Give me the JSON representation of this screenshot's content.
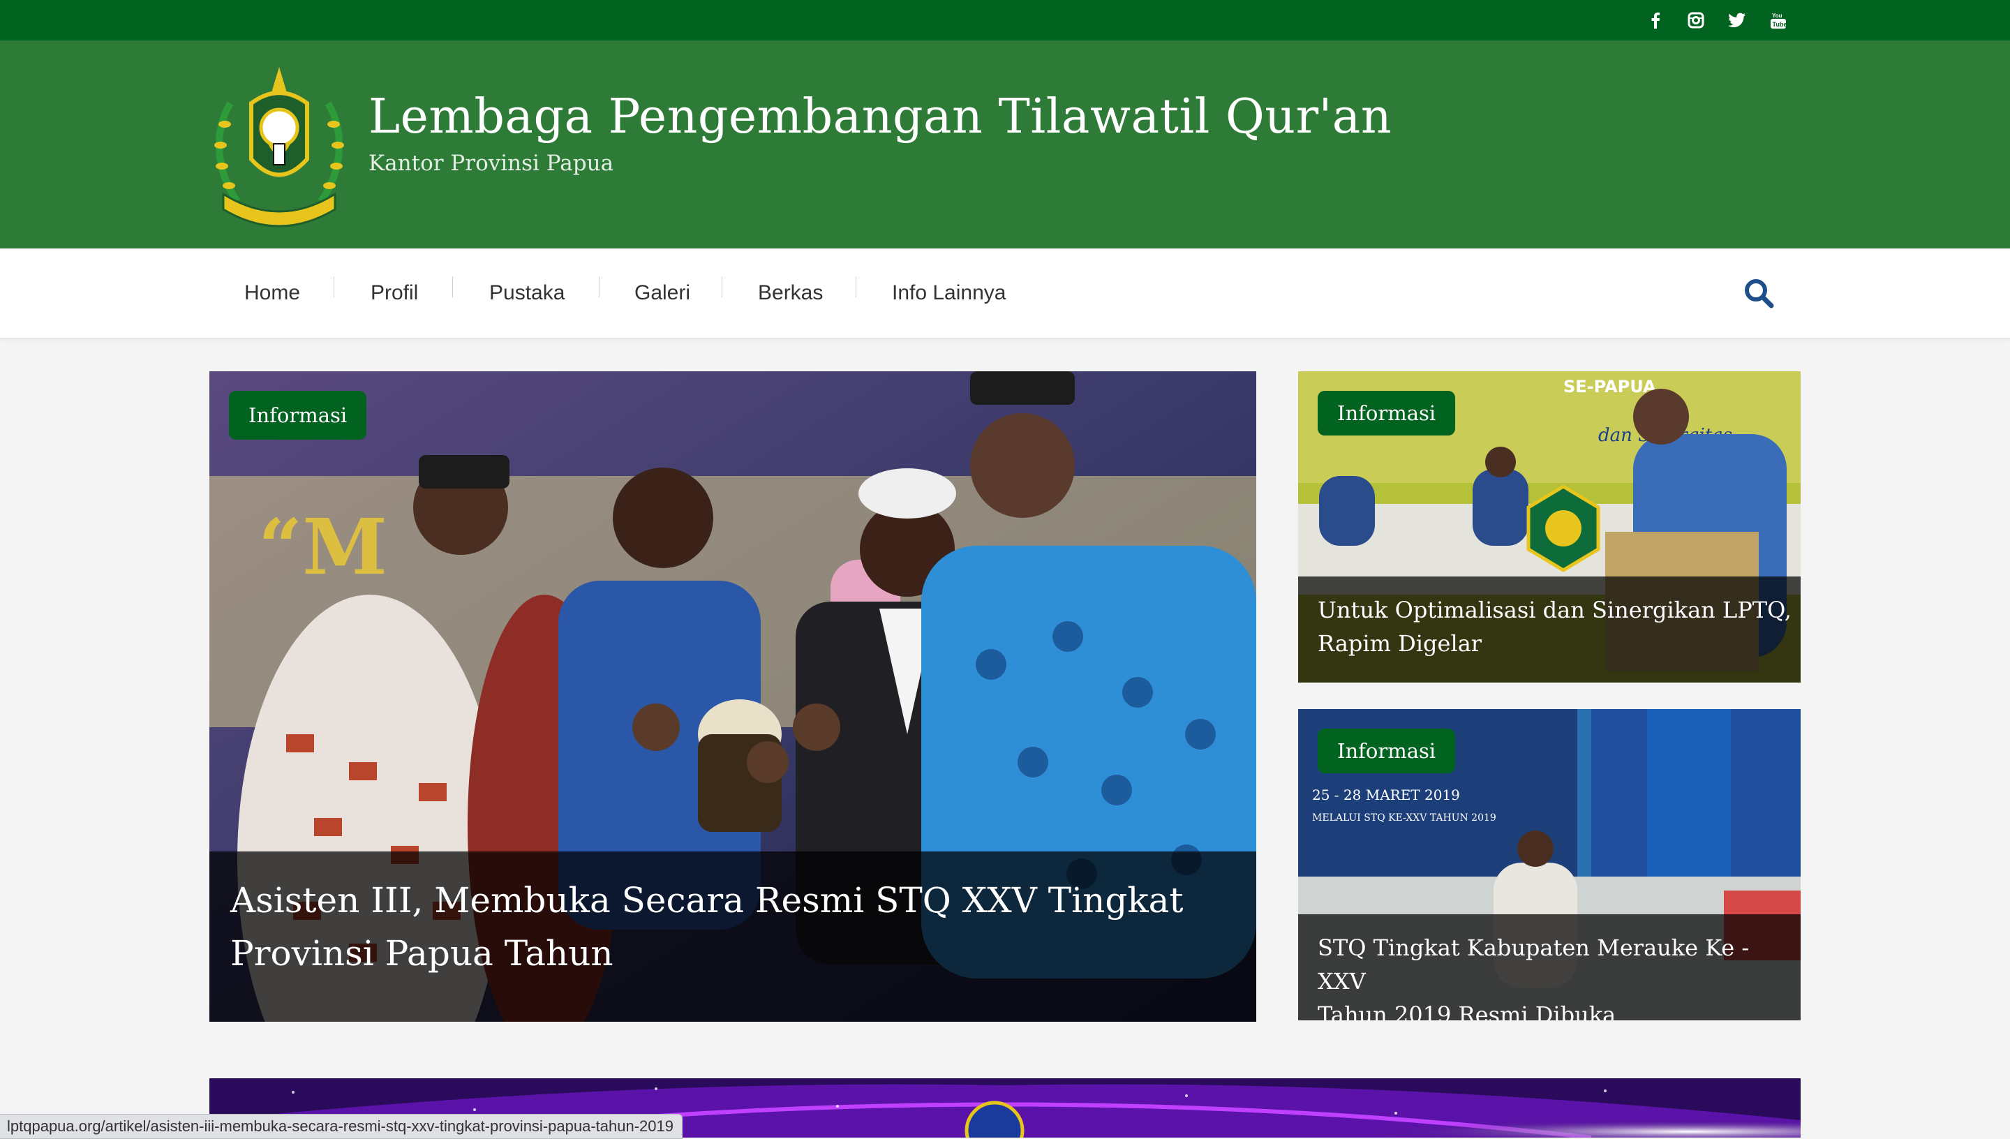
{
  "social": {
    "icons": [
      "facebook-icon",
      "instagram-icon",
      "twitter-icon",
      "youtube-icon"
    ]
  },
  "header": {
    "title": "Lembaga Pengembangan Tilawatil Qur'an",
    "tagline": "Kantor Provinsi Papua"
  },
  "nav": {
    "items": [
      {
        "label": "Home"
      },
      {
        "label": "Profil"
      },
      {
        "label": "Pustaka"
      },
      {
        "label": "Galeri"
      },
      {
        "label": "Berkas"
      },
      {
        "label": "Info Lainnya"
      }
    ],
    "search_icon": "search-icon"
  },
  "featured": {
    "main": {
      "badge": "Informasi",
      "title_line1": "Asisten III, Membuka Secara Resmi STQ XXV Tingkat",
      "title_line2": "Provinsi Papua Tahun"
    },
    "side": [
      {
        "badge": "Informasi",
        "title_line1": "Untuk Optimalisasi dan Sinergikan LPTQ,",
        "title_line2": "Rapim Digelar"
      },
      {
        "badge": "Informasi",
        "title_line1": "STQ Tingkat Kabupaten Merauke Ke - XXV",
        "title_line2": "Tahun 2019 Resmi Dibuka"
      }
    ]
  },
  "status_url": "lptqpapua.org/artikel/asisten-iii-membuka-secara-resmi-stq-xxv-tingkat-provinsi-papua-tahun-2019",
  "colors": {
    "top_bar": "#02621f",
    "header": "#2e7a37",
    "badge": "#02621f",
    "search": "#1f4f8a"
  }
}
